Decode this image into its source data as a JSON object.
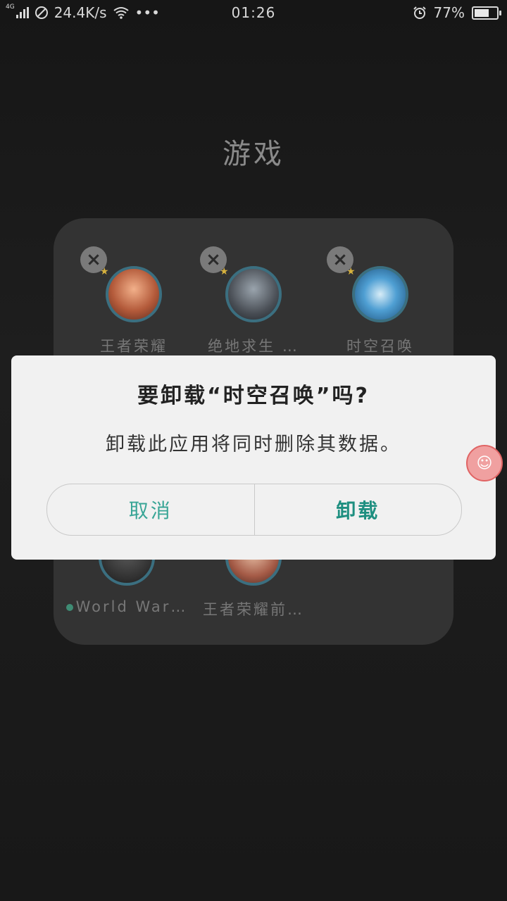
{
  "status_bar": {
    "network_type": "4G",
    "speed": "24.4K/s",
    "more": "•••",
    "time": "01:26",
    "battery": "77%",
    "battery_level": 0.77
  },
  "folder": {
    "title": "游戏",
    "apps": [
      {
        "label": "王者荣耀",
        "icon": "hero-face-icon"
      },
      {
        "label": "绝地求生 …",
        "icon": "soldiers-icon"
      },
      {
        "label": "时空召唤",
        "icon": "blue-s-logo-icon"
      },
      {
        "label": "World War…",
        "icon": "warrior-icon",
        "has_dot": true
      },
      {
        "label": "王者荣耀前…",
        "icon": "hero-face-icon"
      }
    ]
  },
  "dialog": {
    "title": "要卸载“时空召唤”吗?",
    "message": "卸载此应用将同时删除其数据。",
    "cancel": "取消",
    "confirm": "卸载"
  },
  "colors": {
    "accent": "#2a9a8a",
    "dialog_bg": "#f1f1f1",
    "folder_bg": "#333333"
  }
}
